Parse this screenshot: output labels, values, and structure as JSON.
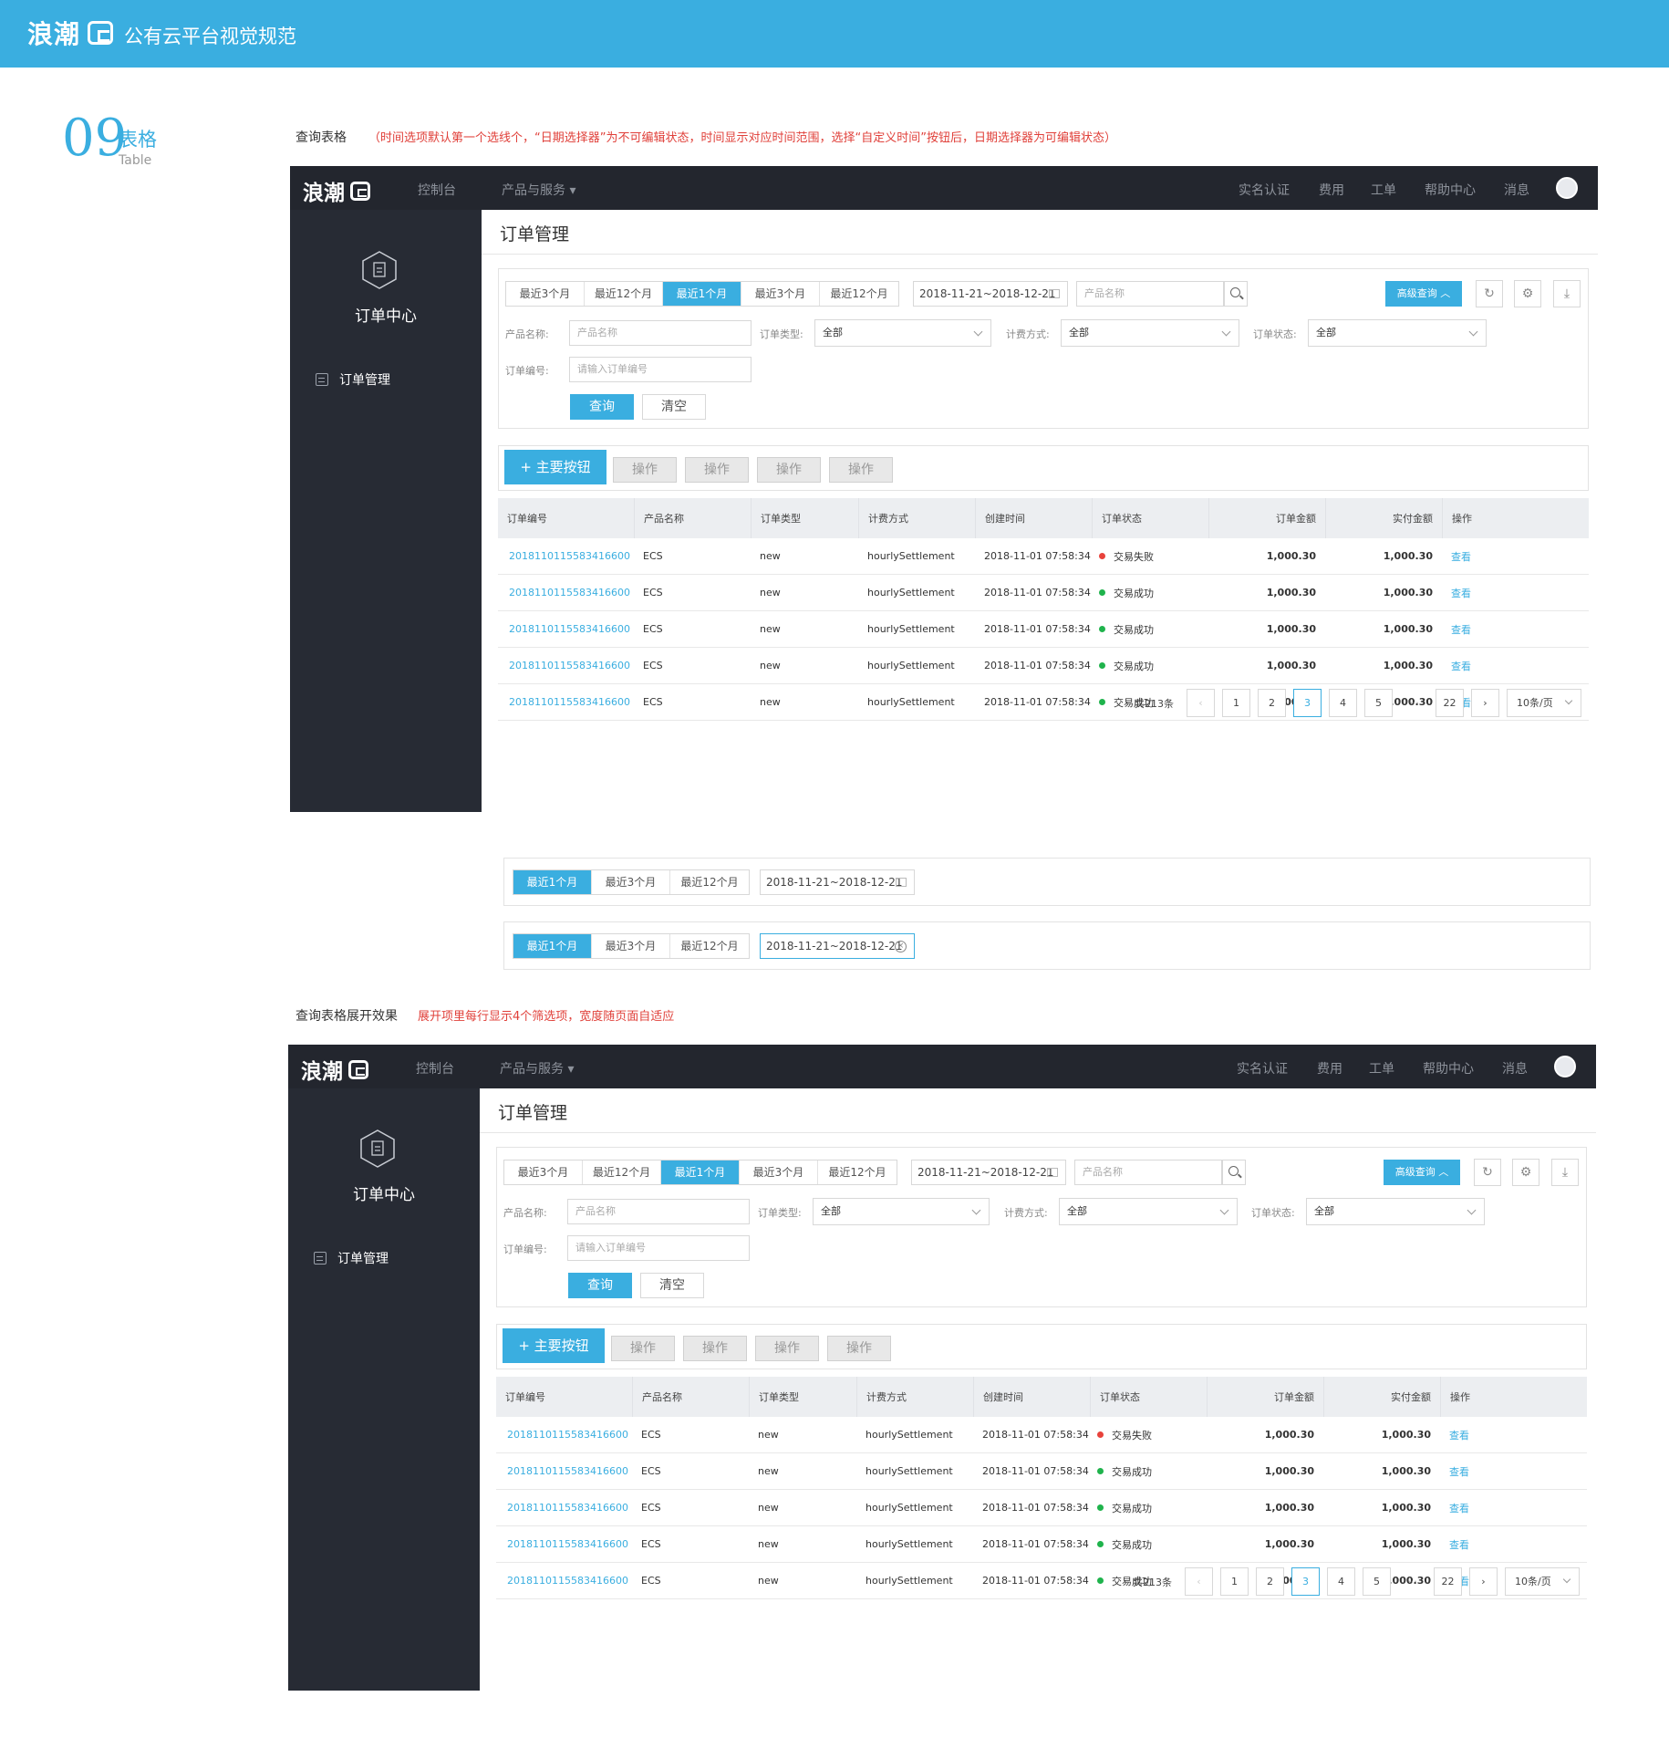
{
  "header": {
    "brand": "浪潮",
    "subtitle": "公有云平台视觉规范"
  },
  "section": {
    "number": "09",
    "title_cn": "表格",
    "title_en": "Table"
  },
  "intro": {
    "label": "查询表格",
    "note": "（时间选项默认第一个选线个，“日期选择器”为不可编辑状态，时间显示对应时间范围，选择“自定义时间”按钮后，日期选择器为可编辑状态）"
  },
  "expand": {
    "label": "查询表格展开效果",
    "note": "展开项里每行显示4个筛选项，宽度随页面自适应"
  },
  "app": {
    "brand": "浪潮",
    "nav_left": [
      "控制台",
      "产品与服务"
    ],
    "nav_right": [
      "实名认证",
      "费用",
      "工单",
      "帮助中心",
      "消息"
    ],
    "side_title": "订单中心",
    "side_item": "订单管理",
    "page_title": "订单管理",
    "tabs": [
      "最近3个月",
      "最近12个月",
      "最近1个月",
      "最近3个月",
      "最近12个月"
    ],
    "date_range": "2018-11-21~2018-12-21",
    "search_placeholder": "产品名称",
    "adv_button": "高级查询",
    "filters": {
      "product_label": "产品名称:",
      "product_placeholder": "产品名称",
      "type_label": "订单类型:",
      "type_value": "全部",
      "billing_label": "计费方式:",
      "billing_value": "全部",
      "status_label": "订单状态:",
      "status_value": "全部",
      "orderno_label": "订单编号:",
      "orderno_placeholder": "请输入订单编号"
    },
    "query_btn": "查询",
    "clear_btn": "清空",
    "primary_btn": "主要按钮",
    "op_btns": [
      "操作",
      "操作",
      "操作",
      "操作"
    ],
    "columns": [
      "订单编号",
      "产品名称",
      "订单类型",
      "计费方式",
      "创建时间",
      "订单状态",
      "订单金额",
      "实付金额",
      "操作"
    ],
    "rows": [
      {
        "id": "2018110115583416600",
        "product": "ECS",
        "type": "new",
        "billing": "hourlySettlement",
        "time": "2018-11-01 07:58:34",
        "status": "交易失败",
        "status_color": "#e8423b",
        "amount": "1,000.30",
        "paid": "1,000.30",
        "action": "查看"
      },
      {
        "id": "2018110115583416600",
        "product": "ECS",
        "type": "new",
        "billing": "hourlySettlement",
        "time": "2018-11-01 07:58:34",
        "status": "交易成功",
        "status_color": "#1fb34c",
        "amount": "1,000.30",
        "paid": "1,000.30",
        "action": "查看"
      },
      {
        "id": "2018110115583416600",
        "product": "ECS",
        "type": "new",
        "billing": "hourlySettlement",
        "time": "2018-11-01 07:58:34",
        "status": "交易成功",
        "status_color": "#1fb34c",
        "amount": "1,000.30",
        "paid": "1,000.30",
        "action": "查看"
      },
      {
        "id": "2018110115583416600",
        "product": "ECS",
        "type": "new",
        "billing": "hourlySettlement",
        "time": "2018-11-01 07:58:34",
        "status": "交易成功",
        "status_color": "#1fb34c",
        "amount": "1,000.30",
        "paid": "1,000.30",
        "action": "查看"
      },
      {
        "id": "2018110115583416600",
        "product": "ECS",
        "type": "new",
        "billing": "hourlySettlement",
        "time": "2018-11-01 07:58:34",
        "status": "交易成功",
        "status_color": "#1fb34c",
        "amount": "1,000.30",
        "paid": "1,000.30",
        "action": "查看"
      }
    ],
    "pager": {
      "total": "共213条",
      "pages": [
        "1",
        "2",
        "3",
        "4",
        "5"
      ],
      "current": "3",
      "ellipsis": "···",
      "last": "22",
      "size": "10条/页"
    }
  },
  "demos": {
    "tabs": [
      "最近1个月",
      "最近3个月",
      "最近12个月"
    ],
    "date_range": "2018-11-21~2018-12-21"
  },
  "colors": {
    "accent": "#3aaee0",
    "nav": "#23262e",
    "sidebar": "#272b34",
    "note": "#e0403a"
  }
}
